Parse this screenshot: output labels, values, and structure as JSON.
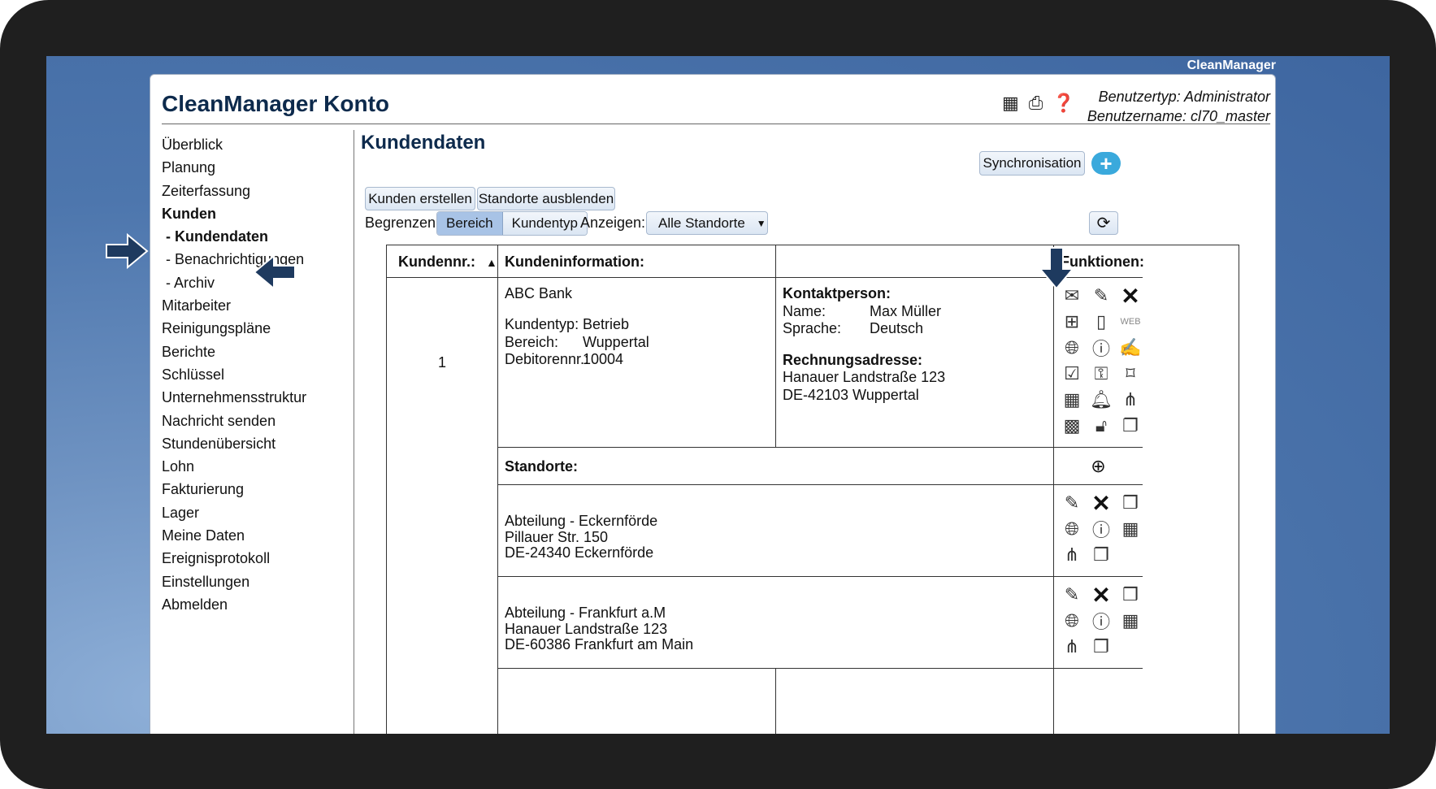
{
  "desktop": {
    "title": "CleanManager"
  },
  "app": {
    "title": "CleanManager Konto",
    "user_type": "Benutzertyp: Administrator",
    "user_name": "Benutzername: cl70_master"
  },
  "sidebar": {
    "items": [
      {
        "label": "Überblick"
      },
      {
        "label": "Planung"
      },
      {
        "label": "Zeiterfassung"
      },
      {
        "label": "Kunden"
      },
      {
        "label": "- Kundendaten"
      },
      {
        "label": "- Benachrichtigungen"
      },
      {
        "label": "- Archiv"
      },
      {
        "label": "Mitarbeiter"
      },
      {
        "label": "Reinigungspläne"
      },
      {
        "label": "Berichte"
      },
      {
        "label": "Schlüssel"
      },
      {
        "label": "Unternehmensstruktur"
      },
      {
        "label": "Nachricht senden"
      },
      {
        "label": "Stundenübersicht"
      },
      {
        "label": "Lohn"
      },
      {
        "label": "Fakturierung"
      },
      {
        "label": "Lager"
      },
      {
        "label": "Meine Daten"
      },
      {
        "label": "Ereignisprotokoll"
      },
      {
        "label": "Einstellungen"
      },
      {
        "label": "Abmelden"
      }
    ]
  },
  "main": {
    "title": "Kundendaten",
    "sync_label": "Synchronisation",
    "add_label": "+",
    "create_customer": "Kunden erstellen",
    "hide_locations": "Standorte ausblenden",
    "limit_label": "Begrenzen:",
    "limit_options": [
      "Bereich",
      "Kundentyp"
    ],
    "show_label": "Anzeigen:",
    "show_value": "Alle Standorte"
  },
  "table": {
    "headers": {
      "number": "Kundennr.:",
      "info": "Kundeninformation:",
      "functions": "Funktionen:"
    },
    "customer": {
      "number": "1",
      "name": "ABC Bank",
      "type_label": "Kundentyp:",
      "type_value": "Betrieb",
      "area_label": "Bereich:",
      "area_value": "Wuppertal",
      "debtor_label": "Debitorennr.:",
      "debtor_value": "10004",
      "contact_title": "Kontaktperson:",
      "contact_name_label": "Name:",
      "contact_name_value": "Max Müller",
      "contact_lang_label": "Sprache:",
      "contact_lang_value": "Deutsch",
      "billing_title": "Rechnungsadresse:",
      "billing_street": "Hanauer Landstraße 123",
      "billing_city": "DE-42103 Wuppertal"
    },
    "locations_title": "Standorte:",
    "locations": [
      {
        "name": "Abteilung - Eckernförde",
        "street": "Pillauer Str. 150",
        "city": "DE-24340 Eckernförde"
      },
      {
        "name": "Abteilung - Frankfurt a.M",
        "street": "Hanauer Landstraße 123",
        "city": "DE-60386 Frankfurt am Main"
      }
    ]
  },
  "icons": {
    "web_label": "WEB"
  }
}
